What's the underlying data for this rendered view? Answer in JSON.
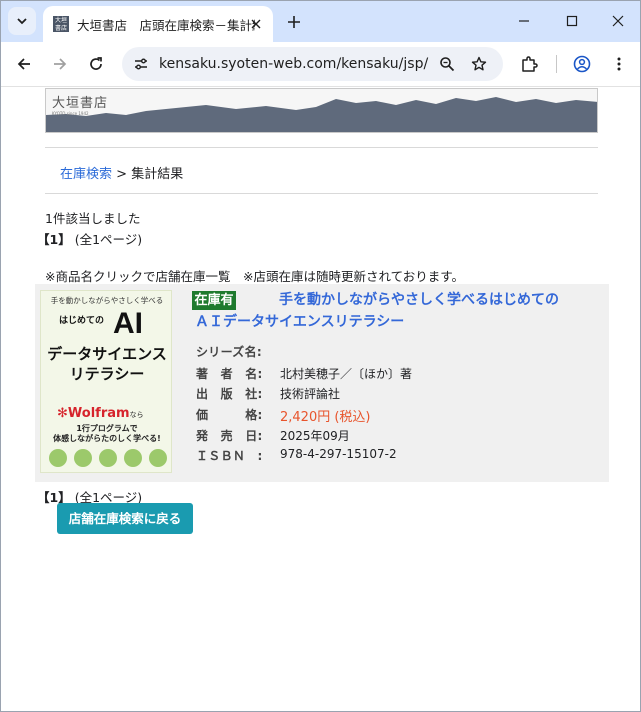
{
  "browser": {
    "tab_title": "大垣書店　店頭在庫検索－集計結果",
    "favicon_text": "大垣\n書店",
    "url": "kensaku.syoten-web.com/kensaku/jsp/Bo..."
  },
  "icons": {
    "tab_search": "chevron-down-icon",
    "tab_close": "close-icon",
    "new_tab": "plus-icon",
    "minimize": "minimize-icon",
    "maximize": "maximize-icon",
    "close_window": "close-icon",
    "back": "arrow-left-icon",
    "forward": "arrow-right-icon",
    "reload": "reload-icon",
    "site_info": "tune-icon",
    "zoom": "zoom-icon",
    "bookmark": "star-icon",
    "extensions": "puzzle-icon",
    "profile": "account-icon",
    "menu": "kebab-menu-icon"
  },
  "banner": {
    "logo": "大垣書店",
    "subtitle": "KYOTO since 1942"
  },
  "breadcrumb": {
    "link": "在庫検索",
    "separator": ">",
    "current": "集計結果"
  },
  "results": {
    "count_text": "1件該当しました",
    "pager_current": "【1】",
    "pager_total": "(全1ページ)",
    "notice": "※商品名クリックで店舗在庫一覧　※店頭在庫は随時更新されております。"
  },
  "book": {
    "stock_badge": "在庫有",
    "title_line1": "手を動かしながらやさしく学べるはじめての",
    "title_line2": "ＡＩデータサイエンスリテラシー",
    "cover": {
      "top": "手を動かしながらやさしく学べる",
      "line1": "はじめての",
      "ai": "AI",
      "line2": "データサイエンス",
      "line3": "リテラシー",
      "wolfram": "Wolfram",
      "wolfram_suffix": "なら",
      "l4": "1行プログラムで",
      "l5": "体感しながらたのしく学べる!"
    },
    "fields": [
      {
        "label": "シリーズ名:",
        "value": ""
      },
      {
        "label": "著　者　名:",
        "value": "北村美穂子／〔ほか〕著"
      },
      {
        "label": "出　版　社:",
        "value": "技術評論社"
      },
      {
        "label": "価　　　格:",
        "value": "2,420円 (税込)"
      },
      {
        "label": "発　売　日:",
        "value": "2025年09月"
      },
      {
        "label": "ＩＳＢＮ　:",
        "value": "978-4-297-15107-2"
      }
    ]
  },
  "buttons": {
    "back_to_search": "店舗在庫検索に戻る"
  }
}
